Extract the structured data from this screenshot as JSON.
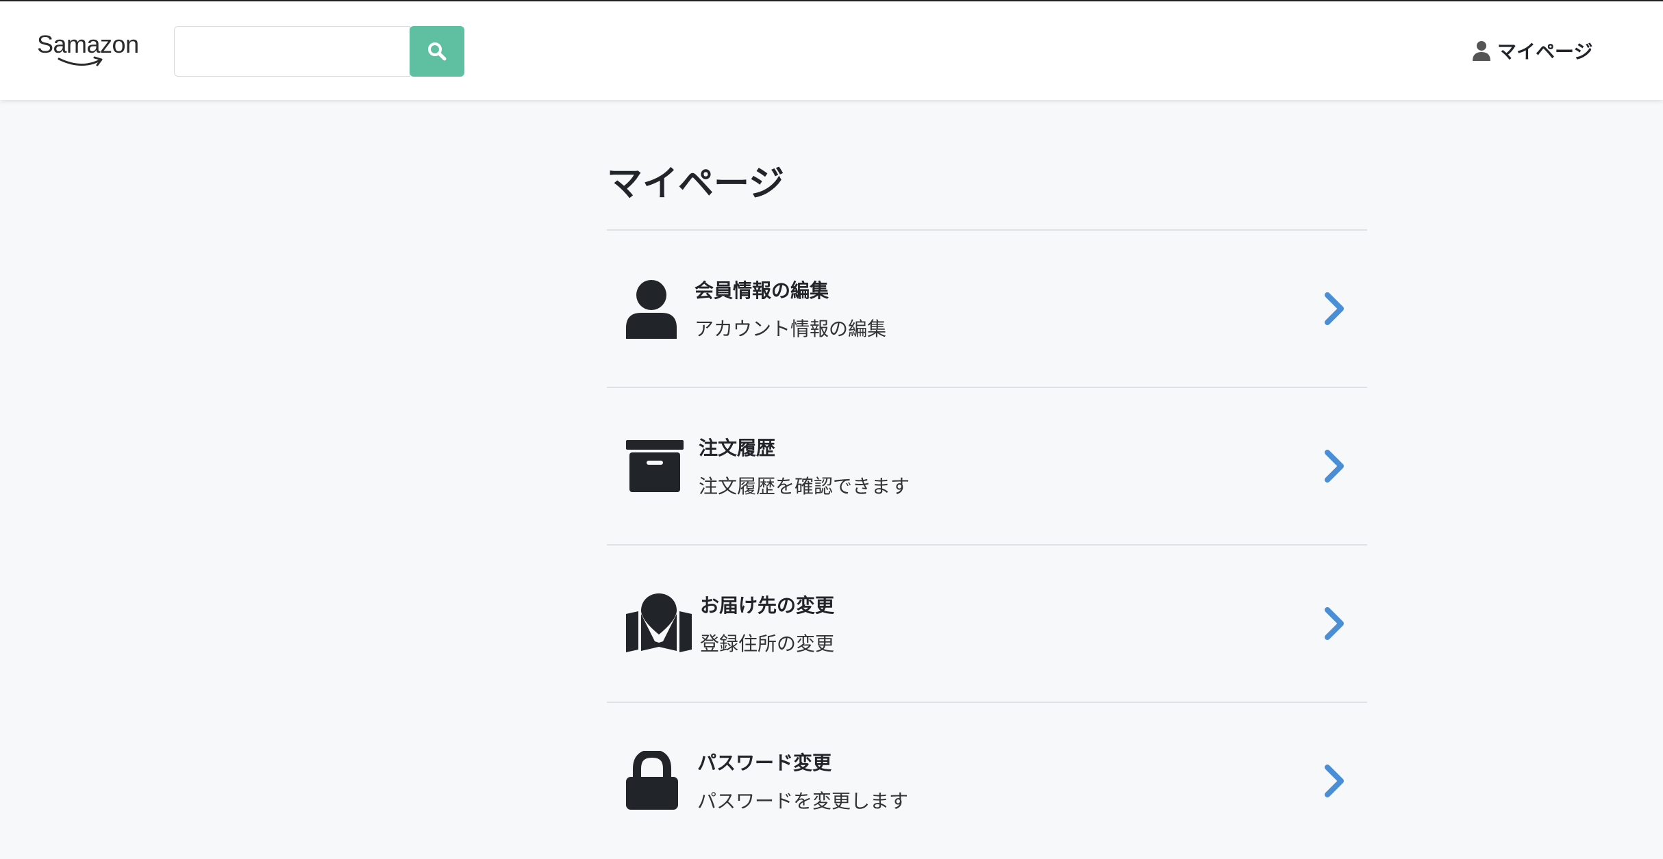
{
  "header": {
    "logo_text": "Samazon",
    "search": {
      "value": "",
      "placeholder": ""
    },
    "mypage_label": "マイページ"
  },
  "main": {
    "title": "マイページ",
    "items": [
      {
        "icon": "user-icon",
        "title": "会員情報の編集",
        "desc": "アカウント情報の編集"
      },
      {
        "icon": "archive-box-icon",
        "title": "注文履歴",
        "desc": "注文履歴を確認できます"
      },
      {
        "icon": "map-pin-icon",
        "title": "お届け先の変更",
        "desc": "登録住所の変更"
      },
      {
        "icon": "lock-icon",
        "title": "パスワード変更",
        "desc": "パスワードを変更します"
      }
    ]
  },
  "colors": {
    "accent": "#5ec0a0",
    "chevron": "#4a8fd6",
    "background": "#f7f8fa"
  }
}
